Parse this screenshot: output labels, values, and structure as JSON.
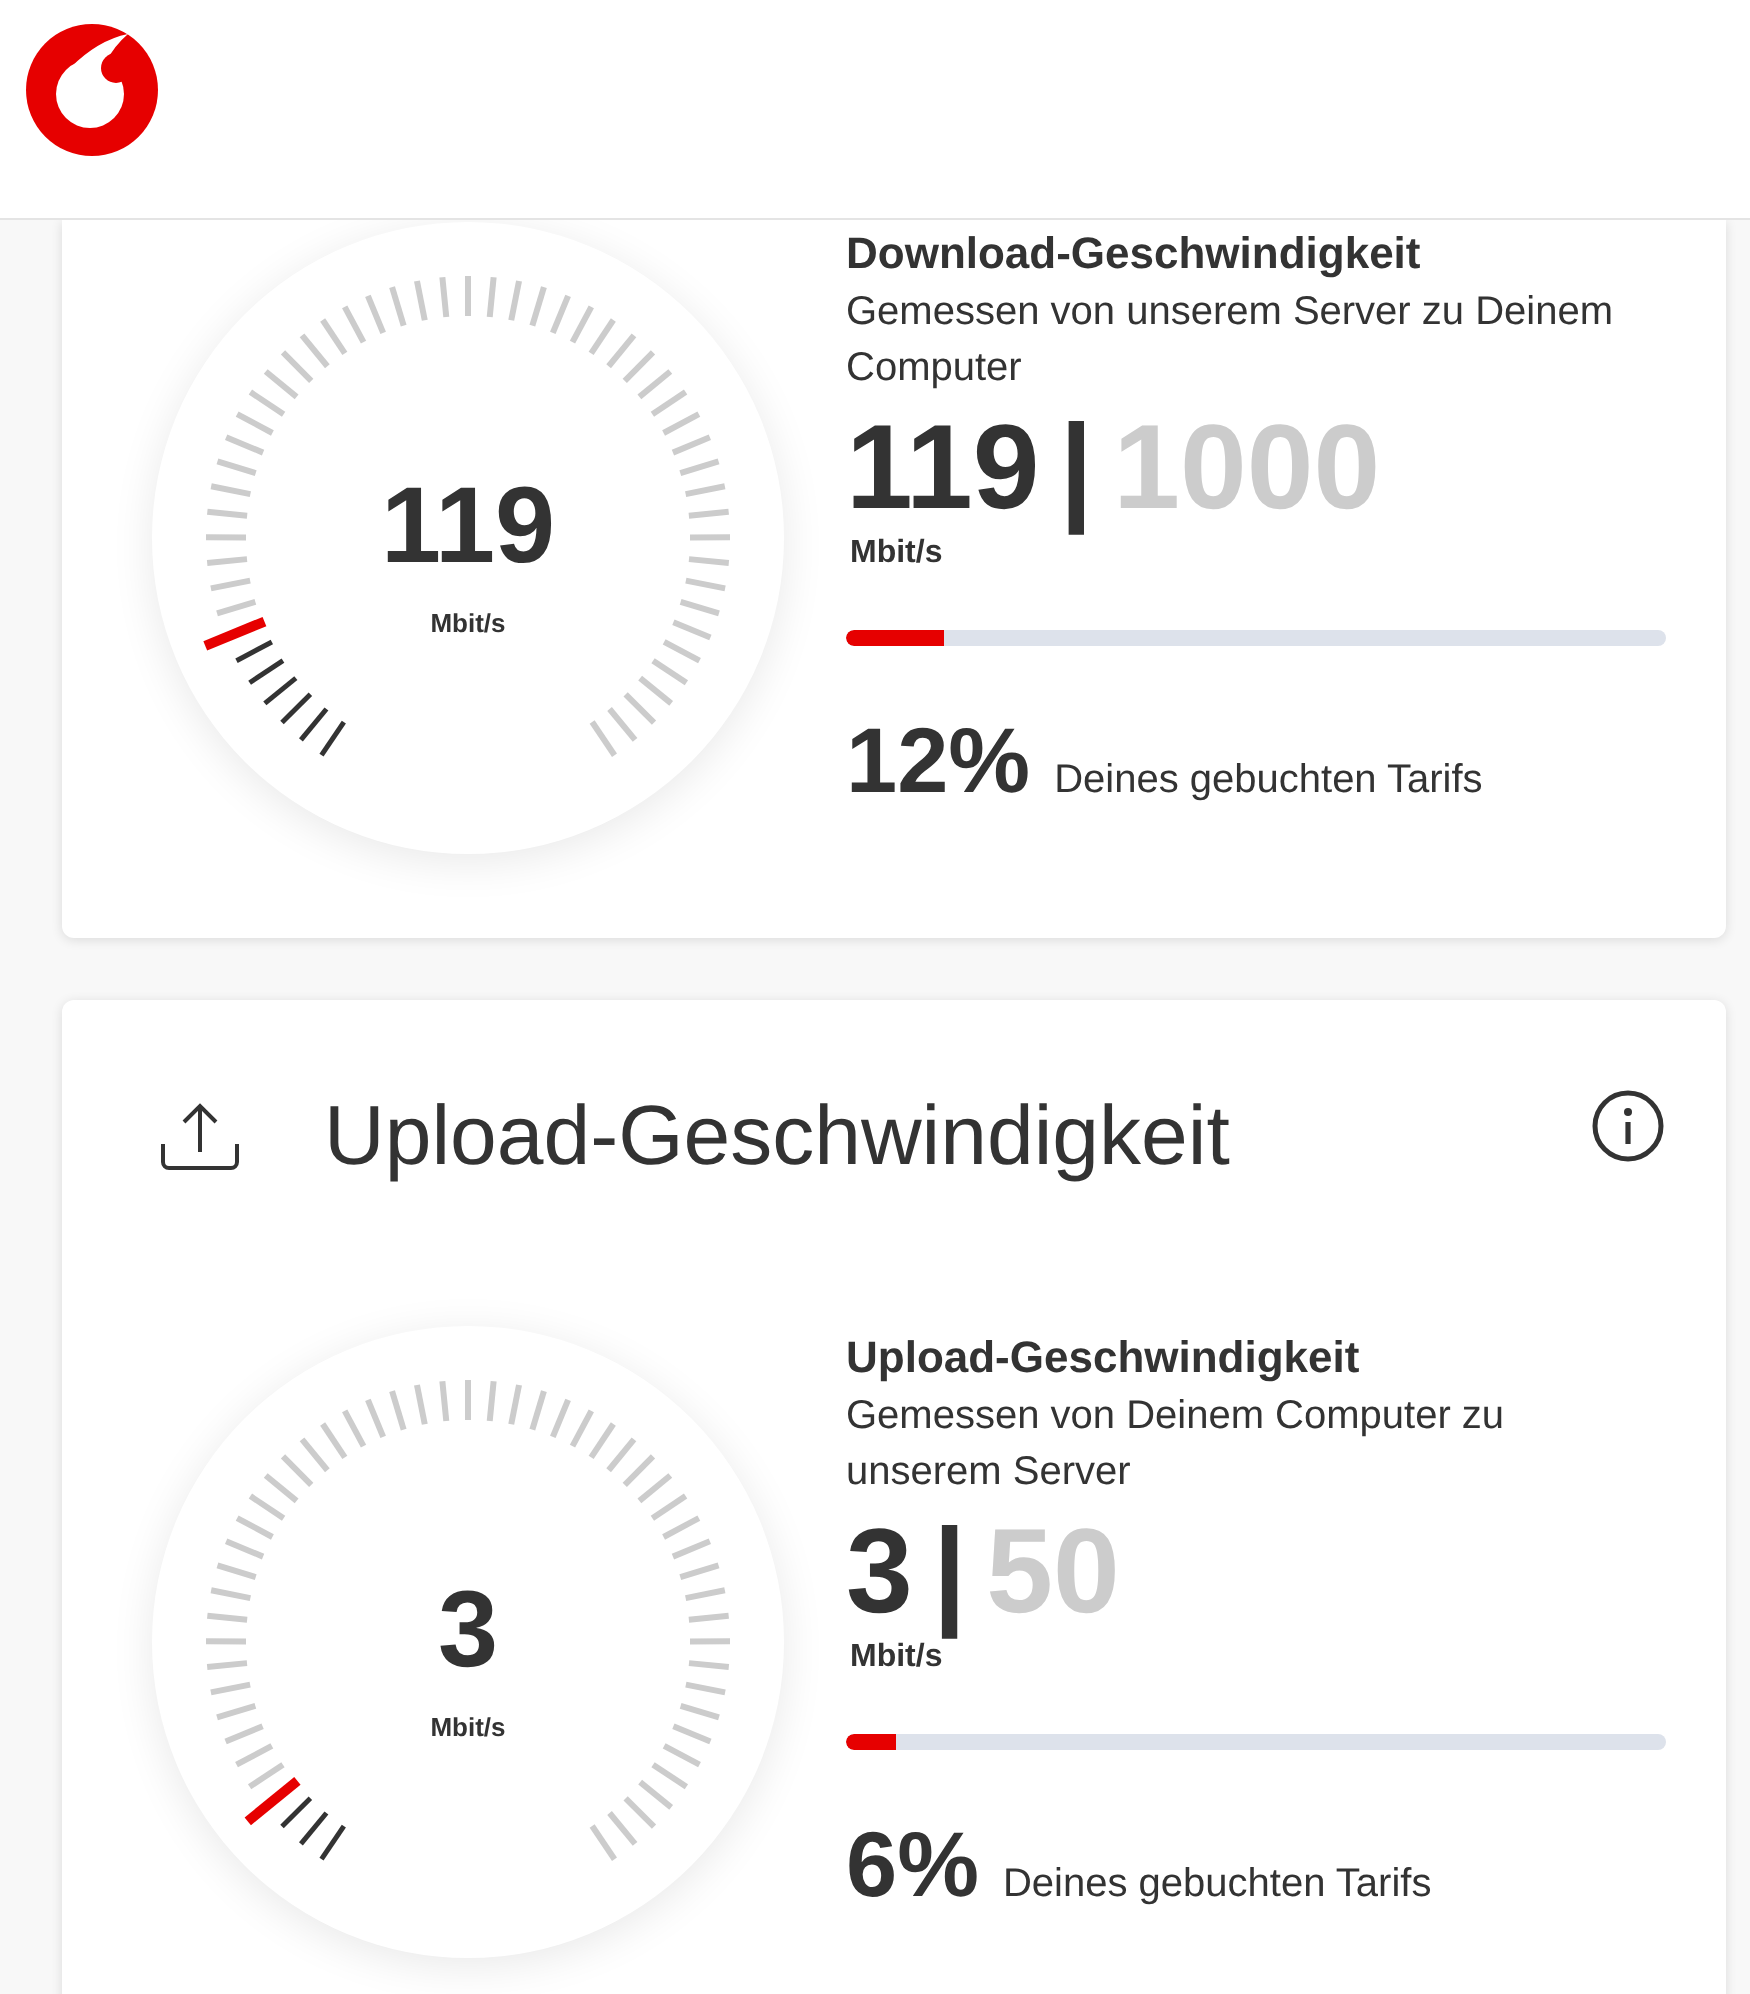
{
  "sections": [
    {
      "gauge": {
        "value": "119",
        "unit": "Mbit/s"
      },
      "title": "Download-Geschwindigkeit",
      "description": "Gemessen von unserem Server zu Deinem Computer",
      "measured": "119",
      "separator": "|",
      "booked": "1000",
      "unit": "Mbit/s",
      "bar": {
        "level": 0.12
      },
      "percent": "12%",
      "percent_label": "Deines gebuchten Tarifs"
    },
    {
      "heading": "Upload-Geschwindigkeit",
      "gauge": {
        "value": "3",
        "unit": "Mbit/s"
      },
      "title": "Upload-Geschwindigkeit",
      "description": "Gemessen von Deinem Computer zu unserem Server",
      "measured": "3",
      "separator": "|",
      "booked": "50",
      "unit": "Mbit/s",
      "bar": {
        "level": 0.06
      },
      "percent": "6%",
      "percent_label": "Deines gebuchten Tarifs"
    }
  ]
}
